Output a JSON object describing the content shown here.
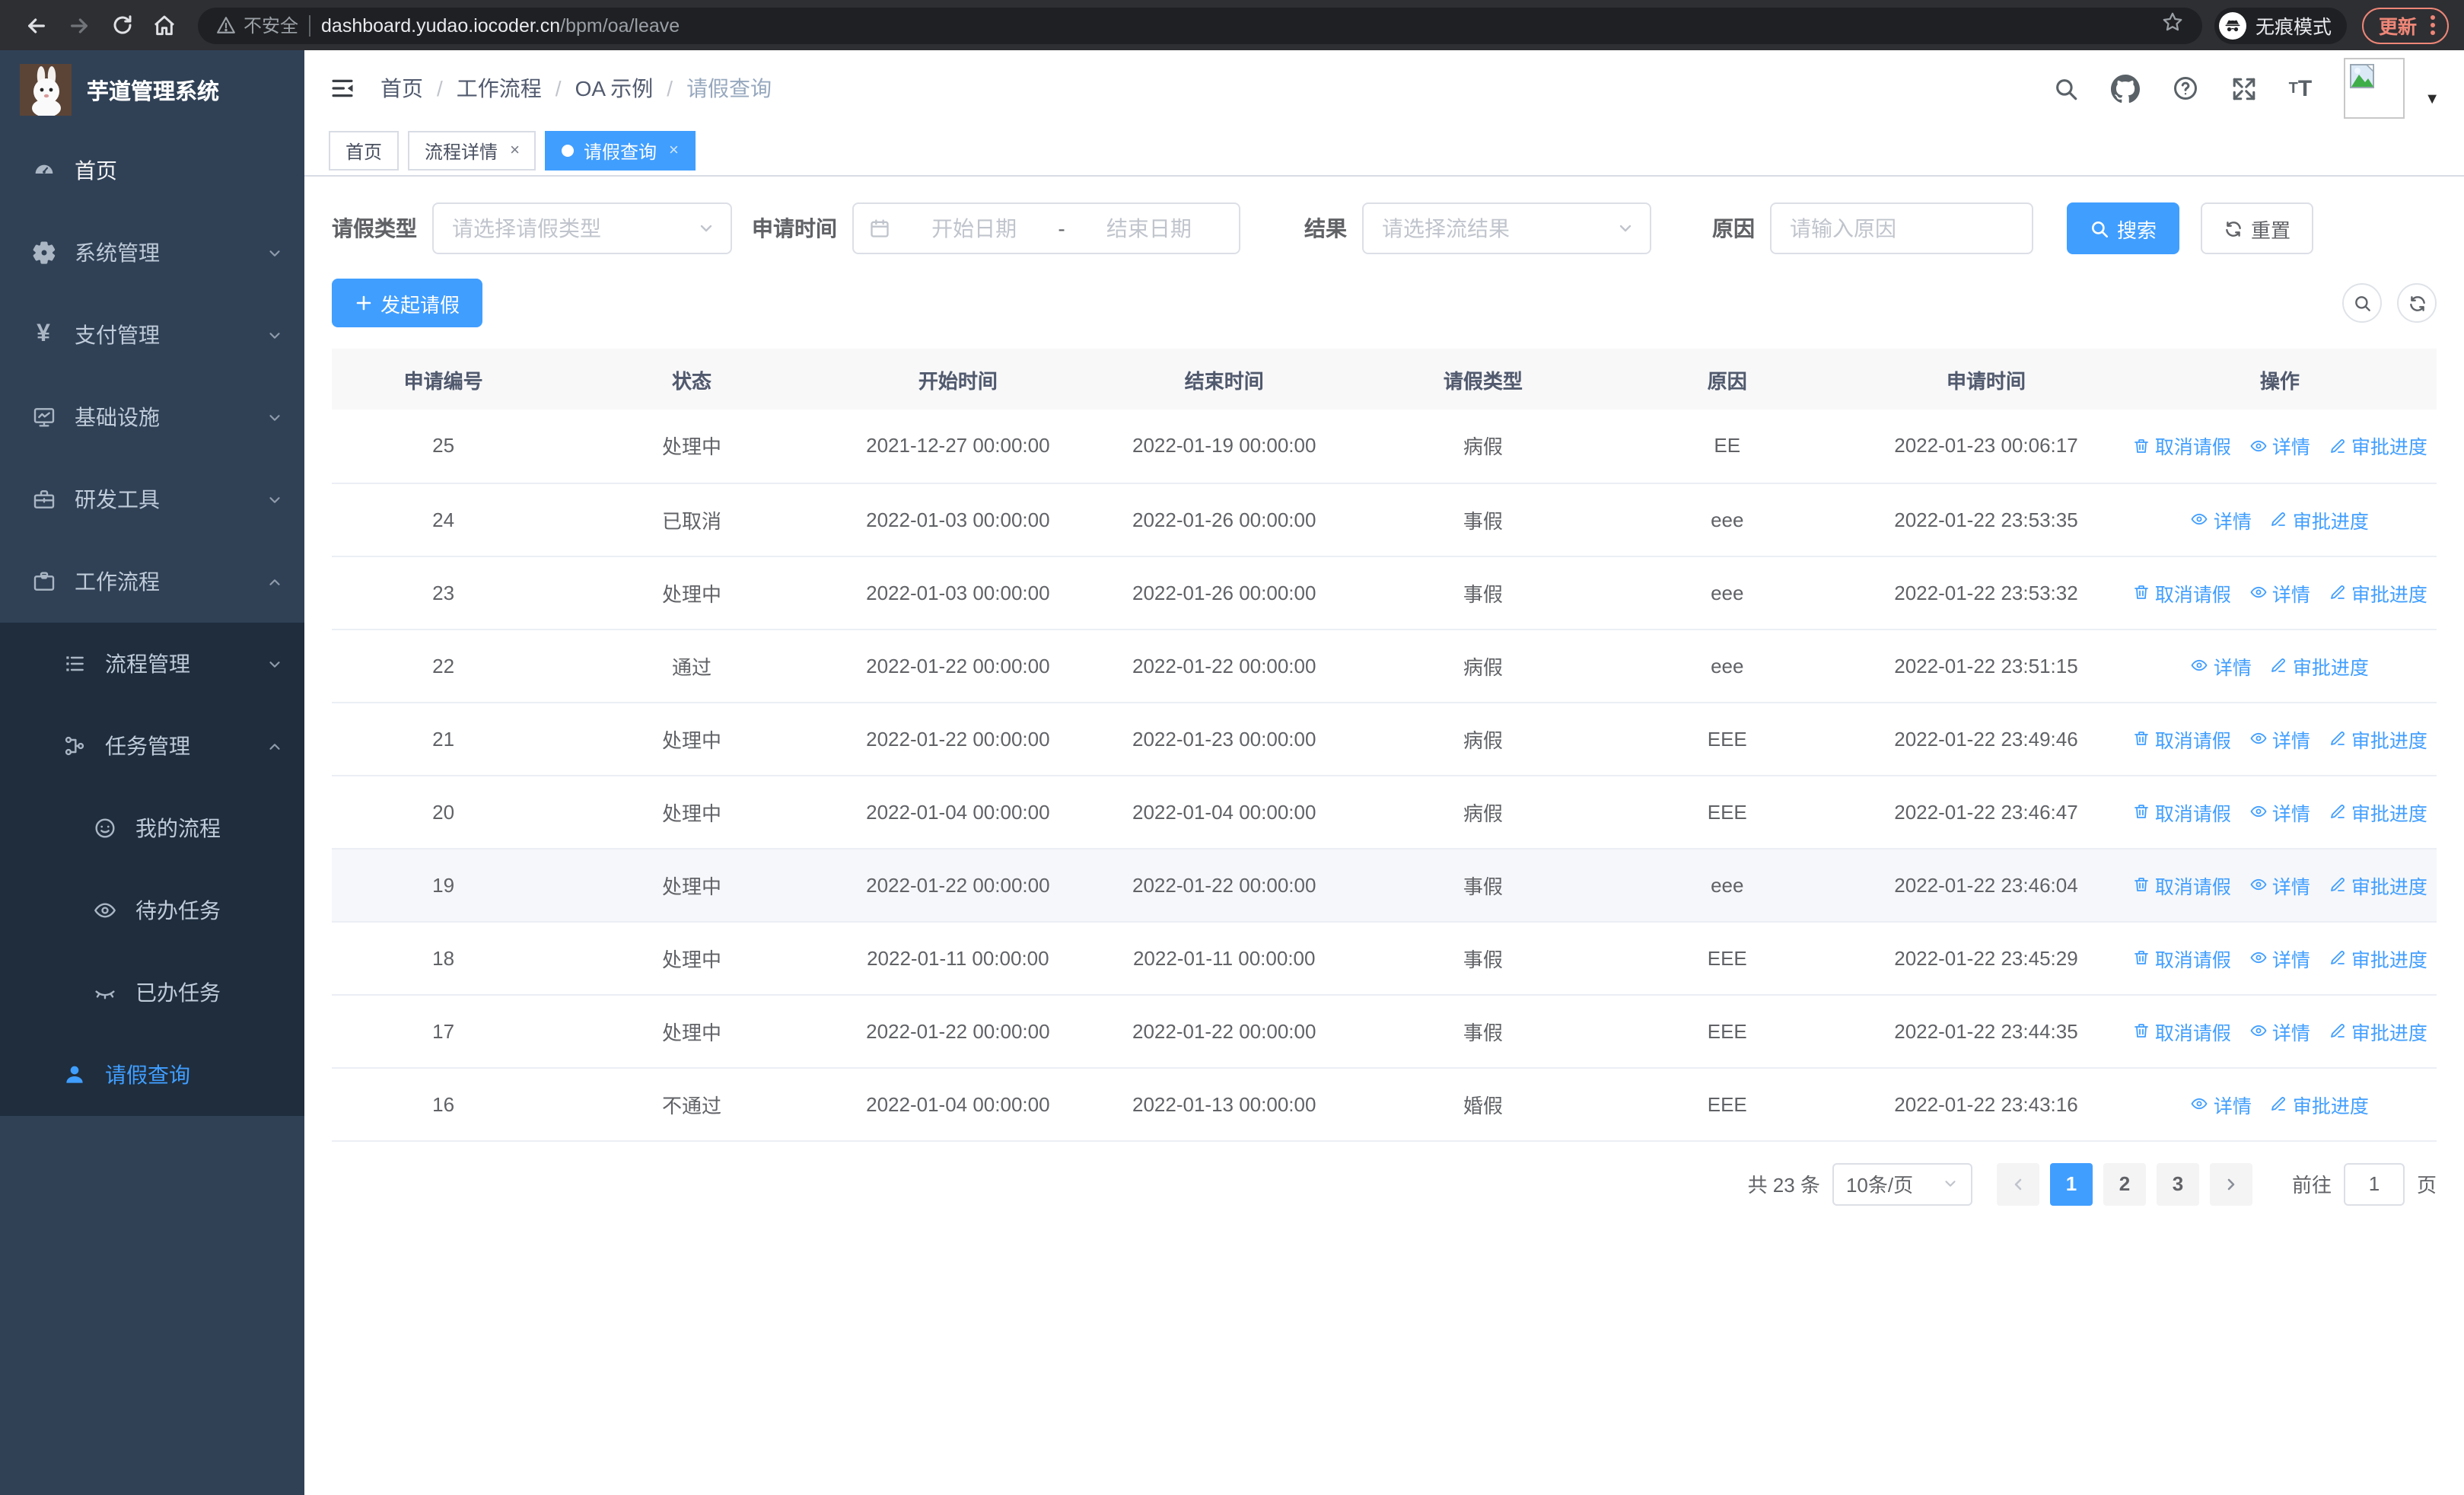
{
  "browser": {
    "security_label": "不安全",
    "url_host": "dashboard.yudao.iocoder.cn",
    "url_path": "/bpm/oa/leave",
    "incognito_label": "无痕模式",
    "update_label": "更新",
    "icons": [
      "back-icon",
      "forward-icon",
      "reload-icon",
      "home-icon",
      "warning-icon",
      "star-icon",
      "incognito-icon",
      "kebab-menu-icon"
    ]
  },
  "sidebar": {
    "title": "芋道管理系统",
    "menu": [
      {
        "label": "首页",
        "icon": "dashboard-icon",
        "level": 1,
        "bright": true
      },
      {
        "label": "系统管理",
        "icon": "gear-icon",
        "level": 1,
        "arrow": "down"
      },
      {
        "label": "支付管理",
        "icon": "yen-icon",
        "level": 1,
        "arrow": "down"
      },
      {
        "label": "基础设施",
        "icon": "monitor-icon",
        "level": 1,
        "arrow": "down"
      },
      {
        "label": "研发工具",
        "icon": "toolbox-icon",
        "level": 1,
        "arrow": "down"
      },
      {
        "label": "工作流程",
        "icon": "briefcase-icon",
        "level": 1,
        "arrow": "up"
      },
      {
        "label": "流程管理",
        "icon": "flow-list-icon",
        "level": 2,
        "arrow": "down",
        "submenu": true
      },
      {
        "label": "任务管理",
        "icon": "org-tree-icon",
        "level": 2,
        "arrow": "up",
        "submenu": true
      },
      {
        "label": "我的流程",
        "icon": "face-icon",
        "level": 3,
        "submenu": true
      },
      {
        "label": "待办任务",
        "icon": "eye-open-icon",
        "level": 3,
        "submenu": true
      },
      {
        "label": "已办任务",
        "icon": "eye-closed-icon",
        "level": 3,
        "submenu": true
      },
      {
        "label": "请假查询",
        "icon": "user-icon",
        "level": 2,
        "submenu": true,
        "active": true
      }
    ]
  },
  "header": {
    "breadcrumb": [
      "首页",
      "工作流程",
      "OA 示例",
      "请假查询"
    ],
    "icons": [
      "fold-icon",
      "search-icon",
      "github-icon",
      "help-icon",
      "fullscreen-icon",
      "font-size-icon",
      "avatar-placeholder-icon",
      "caret-down-icon"
    ]
  },
  "tabs": [
    {
      "label": "首页",
      "closable": false,
      "active": false
    },
    {
      "label": "流程详情",
      "closable": true,
      "active": false
    },
    {
      "label": "请假查询",
      "closable": true,
      "active": true
    }
  ],
  "filters": {
    "leave_type_label": "请假类型",
    "leave_type_placeholder": "请选择请假类型",
    "apply_time_label": "申请时间",
    "date_start_placeholder": "开始日期",
    "date_separator": "-",
    "date_end_placeholder": "结束日期",
    "result_label": "结果",
    "result_placeholder": "请选择流结果",
    "reason_label": "原因",
    "reason_placeholder": "请输入原因",
    "search_label": "搜索",
    "reset_label": "重置"
  },
  "toolbar": {
    "create_label": "发起请假"
  },
  "table": {
    "headers": [
      "申请编号",
      "状态",
      "开始时间",
      "结束时间",
      "请假类型",
      "原因",
      "申请时间",
      "操作"
    ],
    "col_widths": [
      "10.6%",
      "13%",
      "12.3%",
      "13%",
      "11.6%",
      "11.6%",
      "13%",
      "14.9%"
    ],
    "action_labels": {
      "cancel": "取消请假",
      "detail": "详情",
      "progress": "审批进度"
    },
    "rows": [
      {
        "id": "25",
        "status": "处理中",
        "start": "2021-12-27 00:00:00",
        "end": "2022-01-19 00:00:00",
        "type": "病假",
        "reason": "EE",
        "applied": "2022-01-23 00:06:17",
        "actions": [
          "cancel",
          "detail",
          "progress"
        ],
        "highlighted": false
      },
      {
        "id": "24",
        "status": "已取消",
        "start": "2022-01-03 00:00:00",
        "end": "2022-01-26 00:00:00",
        "type": "事假",
        "reason": "eee",
        "applied": "2022-01-22 23:53:35",
        "actions": [
          "detail",
          "progress"
        ],
        "highlighted": false
      },
      {
        "id": "23",
        "status": "处理中",
        "start": "2022-01-03 00:00:00",
        "end": "2022-01-26 00:00:00",
        "type": "事假",
        "reason": "eee",
        "applied": "2022-01-22 23:53:32",
        "actions": [
          "cancel",
          "detail",
          "progress"
        ],
        "highlighted": false
      },
      {
        "id": "22",
        "status": "通过",
        "start": "2022-01-22 00:00:00",
        "end": "2022-01-22 00:00:00",
        "type": "病假",
        "reason": "eee",
        "applied": "2022-01-22 23:51:15",
        "actions": [
          "detail",
          "progress"
        ],
        "highlighted": false
      },
      {
        "id": "21",
        "status": "处理中",
        "start": "2022-01-22 00:00:00",
        "end": "2022-01-23 00:00:00",
        "type": "病假",
        "reason": "EEE",
        "applied": "2022-01-22 23:49:46",
        "actions": [
          "cancel",
          "detail",
          "progress"
        ],
        "highlighted": false
      },
      {
        "id": "20",
        "status": "处理中",
        "start": "2022-01-04 00:00:00",
        "end": "2022-01-04 00:00:00",
        "type": "病假",
        "reason": "EEE",
        "applied": "2022-01-22 23:46:47",
        "actions": [
          "cancel",
          "detail",
          "progress"
        ],
        "highlighted": false
      },
      {
        "id": "19",
        "status": "处理中",
        "start": "2022-01-22 00:00:00",
        "end": "2022-01-22 00:00:00",
        "type": "事假",
        "reason": "eee",
        "applied": "2022-01-22 23:46:04",
        "actions": [
          "cancel",
          "detail",
          "progress"
        ],
        "highlighted": true
      },
      {
        "id": "18",
        "status": "处理中",
        "start": "2022-01-11 00:00:00",
        "end": "2022-01-11 00:00:00",
        "type": "事假",
        "reason": "EEE",
        "applied": "2022-01-22 23:45:29",
        "actions": [
          "cancel",
          "detail",
          "progress"
        ],
        "highlighted": false
      },
      {
        "id": "17",
        "status": "处理中",
        "start": "2022-01-22 00:00:00",
        "end": "2022-01-22 00:00:00",
        "type": "事假",
        "reason": "EEE",
        "applied": "2022-01-22 23:44:35",
        "actions": [
          "cancel",
          "detail",
          "progress"
        ],
        "highlighted": false
      },
      {
        "id": "16",
        "status": "不通过",
        "start": "2022-01-04 00:00:00",
        "end": "2022-01-13 00:00:00",
        "type": "婚假",
        "reason": "EEE",
        "applied": "2022-01-22 23:43:16",
        "actions": [
          "detail",
          "progress"
        ],
        "highlighted": false
      }
    ]
  },
  "pagination": {
    "total_label": "共 23 条",
    "page_size_label": "10条/页",
    "pages": [
      "1",
      "2",
      "3"
    ],
    "current_page": "1",
    "goto_label": "前往",
    "goto_value": "1",
    "page_unit_label": "页"
  },
  "colors": {
    "primary": "#409eff",
    "sidebar_bg": "#304156",
    "submenu_bg": "#1f2d3d",
    "update_accent": "#ee8677"
  }
}
